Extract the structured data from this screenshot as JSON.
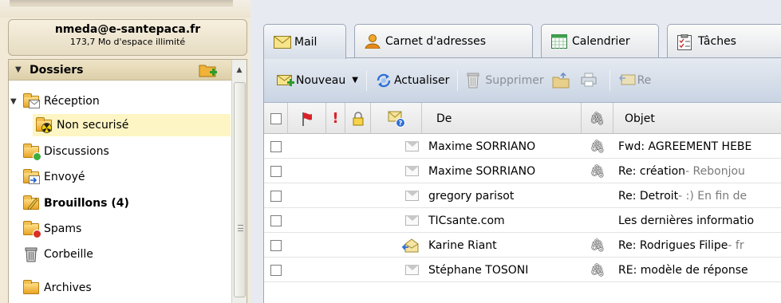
{
  "account": {
    "email": "nmeda@e-santepaca.fr",
    "quota": "173,7 Mo d'espace illimité"
  },
  "folders": {
    "header": "Dossiers",
    "items": [
      {
        "label": "Réception",
        "icon": "inbox-folder-icon"
      },
      {
        "label": "Non securisé",
        "icon": "hazard-folder-icon"
      },
      {
        "label": "Discussions",
        "icon": "discussions-folder-icon"
      },
      {
        "label": "Envoyé",
        "icon": "sent-folder-icon"
      },
      {
        "label": "Brouillons (4)",
        "icon": "drafts-folder-icon"
      },
      {
        "label": "Spams",
        "icon": "spam-folder-icon"
      },
      {
        "label": "Corbeille",
        "icon": "trash-icon"
      },
      {
        "label": "Archives",
        "icon": "archive-folder-icon"
      }
    ]
  },
  "tabs": [
    {
      "label": "Mail",
      "icon": "mail-icon"
    },
    {
      "label": "Carnet d'adresses",
      "icon": "contacts-icon"
    },
    {
      "label": "Calendrier",
      "icon": "calendar-icon"
    },
    {
      "label": "Tâches",
      "icon": "tasks-icon"
    }
  ],
  "toolbar": {
    "new_label": "Nouveau",
    "refresh_label": "Actualiser",
    "delete_label": "Supprimer",
    "reply_partial": "Re"
  },
  "columns": {
    "from": "De",
    "subject": "Objet"
  },
  "messages": [
    {
      "from": "Maxime SORRIANO",
      "attachment": true,
      "subject": "Fwd: AGREEMENT HEBE",
      "preview": "",
      "replied": false
    },
    {
      "from": "Maxime SORRIANO",
      "attachment": true,
      "subject": "Re: création",
      "preview": " - Rebonjou",
      "replied": false
    },
    {
      "from": "gregory parisot",
      "attachment": false,
      "subject": "Re: Detroit",
      "preview": " - :) En fin de",
      "replied": false
    },
    {
      "from": "TICsante.com",
      "attachment": false,
      "subject": "Les dernières informatio",
      "preview": "",
      "replied": false
    },
    {
      "from": "Karine Riant",
      "attachment": true,
      "subject": "Re: Rodrigues Filipe",
      "preview": " - fr",
      "replied": true
    },
    {
      "from": "Stéphane TOSONI",
      "attachment": true,
      "subject": "RE: modèle de réponse",
      "preview": "",
      "replied": false
    }
  ],
  "colors": {
    "left_bg": "#f2ead7",
    "selected_bg": "#fdf5c3",
    "toolbar_bg": "#c9d4e3",
    "folder_yellow": "#f0b338"
  }
}
